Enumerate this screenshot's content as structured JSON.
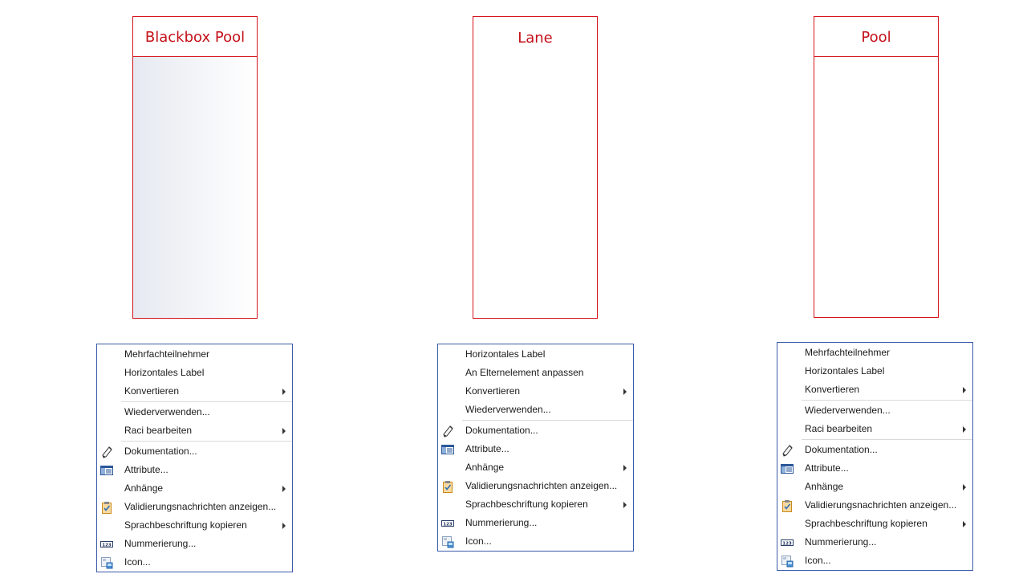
{
  "shapes": {
    "blackbox_pool": {
      "title": "Blackbox Pool"
    },
    "lane": {
      "title": "Lane"
    },
    "pool": {
      "title": "Pool"
    }
  },
  "menu_left": {
    "items": [
      {
        "label": "Mehrfachteilnehmer"
      },
      {
        "label": "Horizontales Label"
      },
      {
        "label": "Konvertieren",
        "submenu": true
      },
      {
        "separator": true
      },
      {
        "label": "Wiederverwenden..."
      },
      {
        "label": "Raci bearbeiten",
        "submenu": true
      },
      {
        "separator": true
      },
      {
        "label": "Dokumentation...",
        "icon": "pencil-icon"
      },
      {
        "label": "Attribute...",
        "icon": "attributes-table-icon"
      },
      {
        "label": "Anhänge",
        "submenu": true
      },
      {
        "label": "Validierungsnachrichten anzeigen...",
        "icon": "clipboard-check-icon"
      },
      {
        "label": "Sprachbeschriftung kopieren",
        "submenu": true
      },
      {
        "label": "Nummerierung...",
        "icon": "numbering-123-icon"
      },
      {
        "label": "Icon...",
        "icon": "image-icon"
      }
    ]
  },
  "menu_middle": {
    "items": [
      {
        "label": "Horizontales Label"
      },
      {
        "label": "An Elternelement anpassen"
      },
      {
        "label": "Konvertieren",
        "submenu": true
      },
      {
        "label": "Wiederverwenden..."
      },
      {
        "separator": true
      },
      {
        "label": "Dokumentation...",
        "icon": "pencil-icon"
      },
      {
        "label": "Attribute...",
        "icon": "attributes-table-icon"
      },
      {
        "label": "Anhänge",
        "submenu": true
      },
      {
        "label": "Validierungsnachrichten anzeigen...",
        "icon": "clipboard-check-icon"
      },
      {
        "label": "Sprachbeschriftung kopieren",
        "submenu": true
      },
      {
        "label": "Nummerierung...",
        "icon": "numbering-123-icon"
      },
      {
        "label": "Icon...",
        "icon": "image-icon"
      }
    ]
  },
  "menu_right": {
    "items": [
      {
        "label": "Mehrfachteilnehmer"
      },
      {
        "label": "Horizontales Label"
      },
      {
        "label": "Konvertieren",
        "submenu": true
      },
      {
        "separator": true
      },
      {
        "label": "Wiederverwenden..."
      },
      {
        "label": "Raci bearbeiten",
        "submenu": true
      },
      {
        "separator": true
      },
      {
        "label": "Dokumentation...",
        "icon": "pencil-icon"
      },
      {
        "label": "Attribute...",
        "icon": "attributes-table-icon"
      },
      {
        "label": "Anhänge",
        "submenu": true
      },
      {
        "label": "Validierungsnachrichten anzeigen...",
        "icon": "clipboard-check-icon"
      },
      {
        "label": "Sprachbeschriftung kopieren",
        "submenu": true
      },
      {
        "label": "Nummerierung...",
        "icon": "numbering-123-icon"
      },
      {
        "label": "Icon...",
        "icon": "image-icon"
      }
    ]
  }
}
